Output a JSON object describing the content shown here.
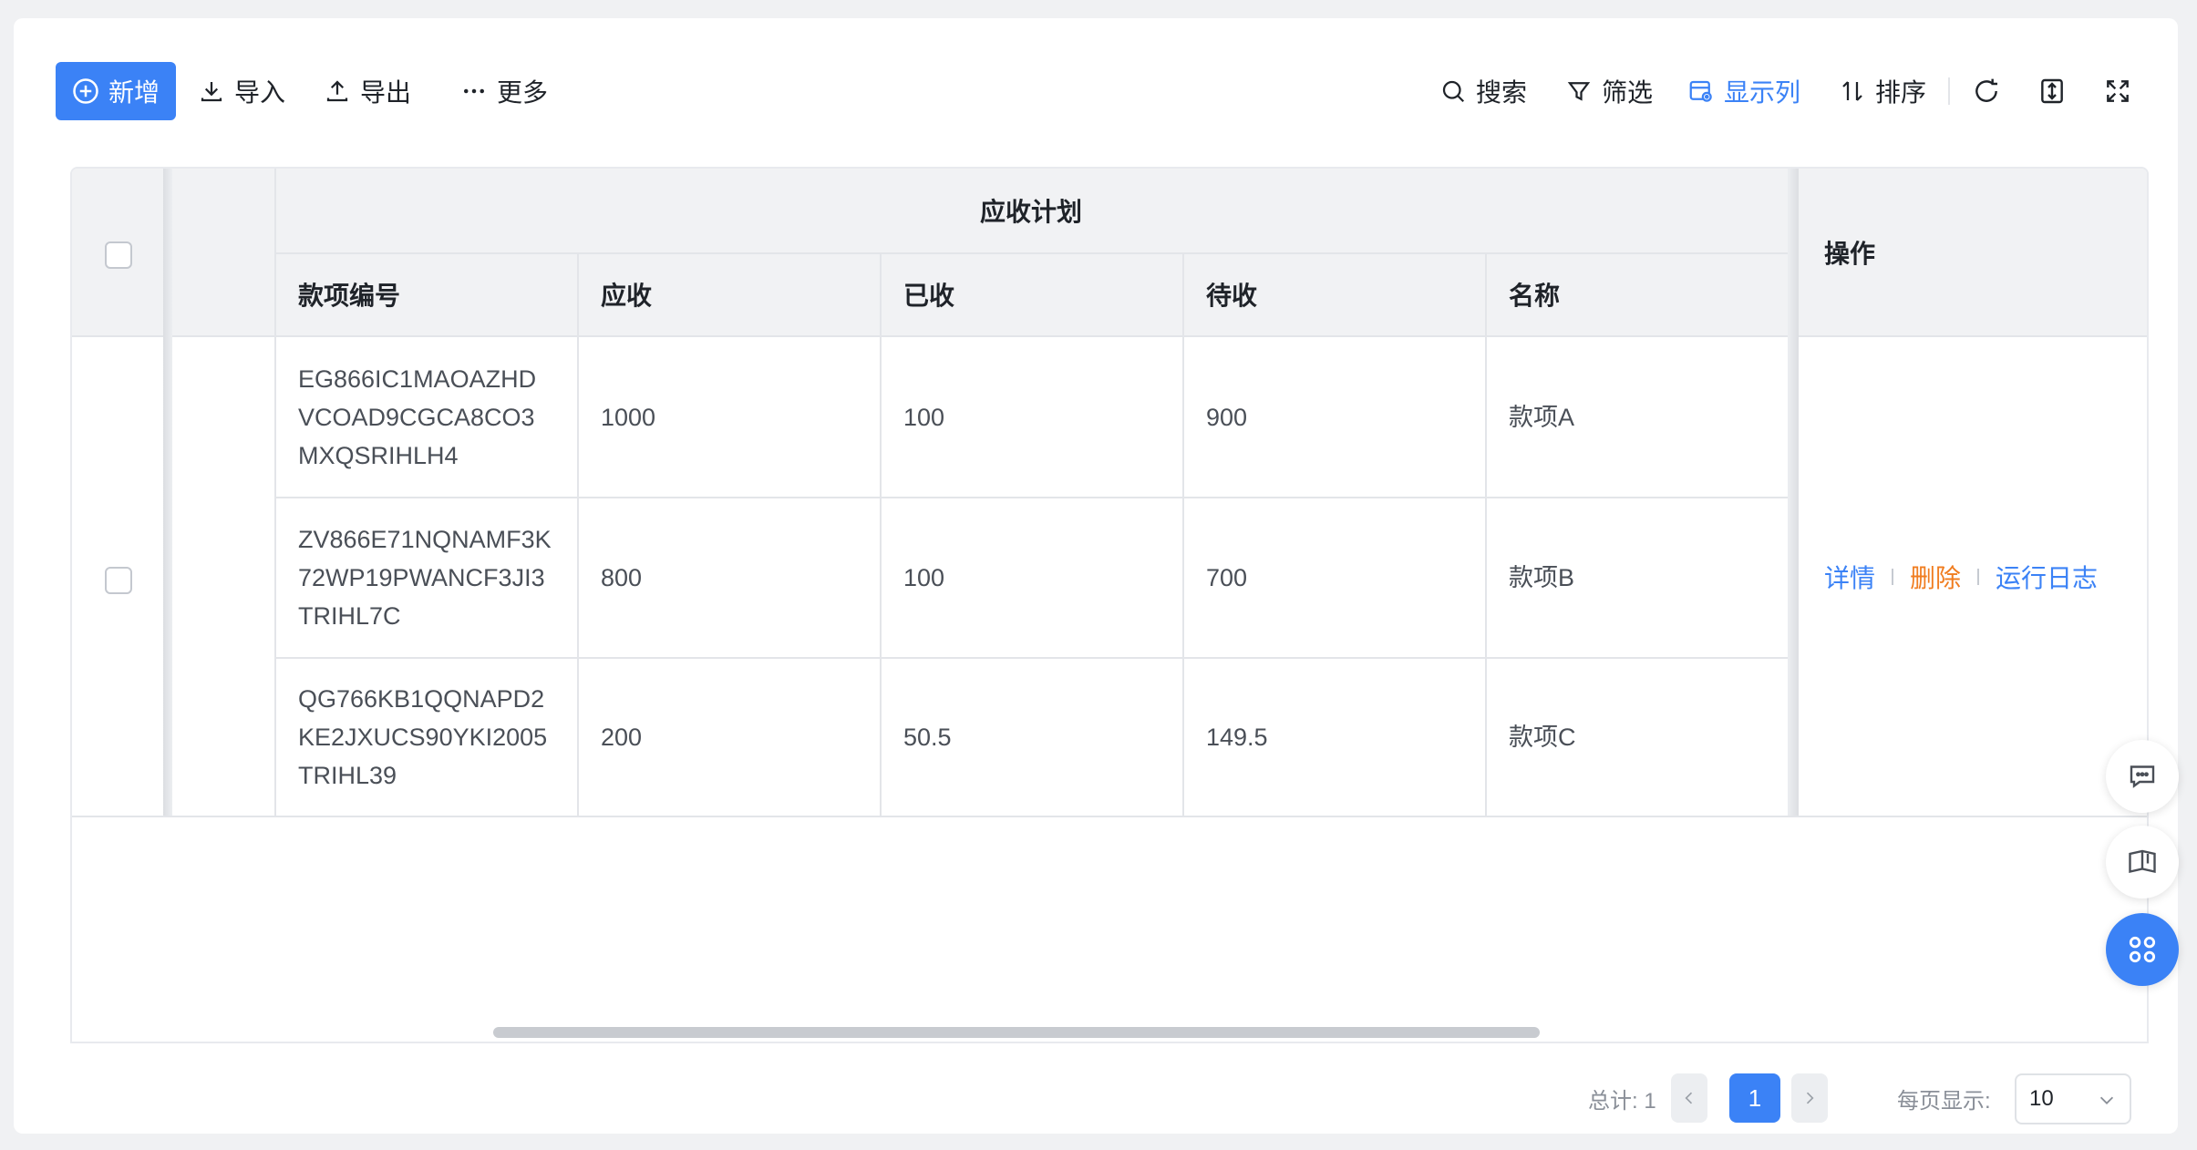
{
  "toolbar": {
    "add_label": "新增",
    "import_label": "导入",
    "export_label": "导出",
    "more_label": "更多",
    "search_label": "搜索",
    "filter_label": "筛选",
    "columns_label": "显示列",
    "sort_label": "排序"
  },
  "table": {
    "group_header": "应收计划",
    "columns": [
      "款项编号",
      "应收",
      "已收",
      "待收",
      "名称"
    ],
    "operation_header": "操作",
    "rows": [
      {
        "code": "EG866IC1MAOAZHD\nVCOAD9CGCA8CO3\nMXQSRIHLH4",
        "receivable": "1000",
        "received": "100",
        "pending": "900",
        "name": "款项A"
      },
      {
        "code": "ZV866E71NQNAMF3K\n72WP19PWANCF3JI3\nTRIHL7C",
        "receivable": "800",
        "received": "100",
        "pending": "700",
        "name": "款项B"
      },
      {
        "code": "QG766KB1QQNAPD2\nKE2JXUCS90YKI2005\nTRIHL39",
        "receivable": "200",
        "received": "50.5",
        "pending": "149.5",
        "name": "款项C"
      }
    ],
    "actions": {
      "detail": "详情",
      "delete": "删除",
      "log": "运行日志"
    }
  },
  "pagination": {
    "total_label": "总计: 1",
    "current_page": "1",
    "per_page_label": "每页显示:",
    "per_page_value": "10"
  },
  "colors": {
    "primary": "#3b82f6",
    "danger_link": "#f07d20"
  },
  "icons": [
    "plus-circle-icon",
    "download-icon",
    "upload-icon",
    "more-icon",
    "search-icon",
    "filter-icon",
    "columns-icon",
    "sort-icon",
    "refresh-icon",
    "row-height-icon",
    "fullscreen-icon",
    "chat-icon",
    "manual-icon",
    "apps-icon"
  ]
}
